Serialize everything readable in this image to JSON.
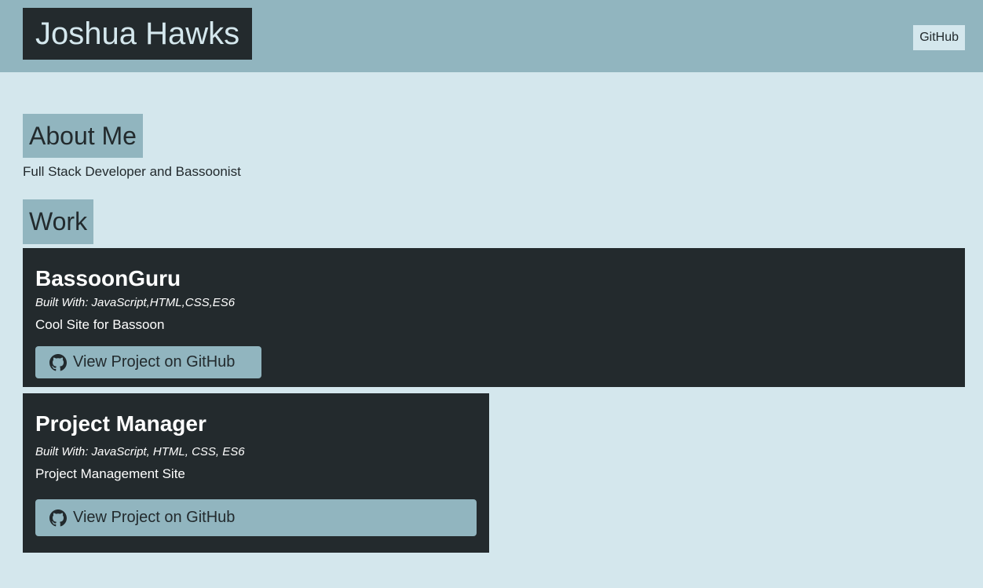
{
  "header": {
    "title": "Joshua Hawks",
    "github_link": "GitHub"
  },
  "about": {
    "heading": "About Me",
    "text": "Full Stack Developer and Bassoonist"
  },
  "work": {
    "heading": "Work",
    "projects": [
      {
        "title": "BassoonGuru",
        "built_with": "Built With: JavaScript,HTML,CSS,ES6",
        "description": "Cool Site for Bassoon",
        "button_label": "View Project on GitHub",
        "button_icon": "github-icon"
      },
      {
        "title": "Project Manager",
        "built_with": "Built With: JavaScript, HTML, CSS, ES6",
        "description": "Project Management Site",
        "button_label": "View Project on GitHub",
        "button_icon": "github-icon"
      }
    ]
  },
  "colors": {
    "page_background": "#d4e7ed",
    "accent": "#91b5bf",
    "dark": "#232a2d",
    "text_dark": "#222a2d",
    "text_light": "#ffffff"
  }
}
